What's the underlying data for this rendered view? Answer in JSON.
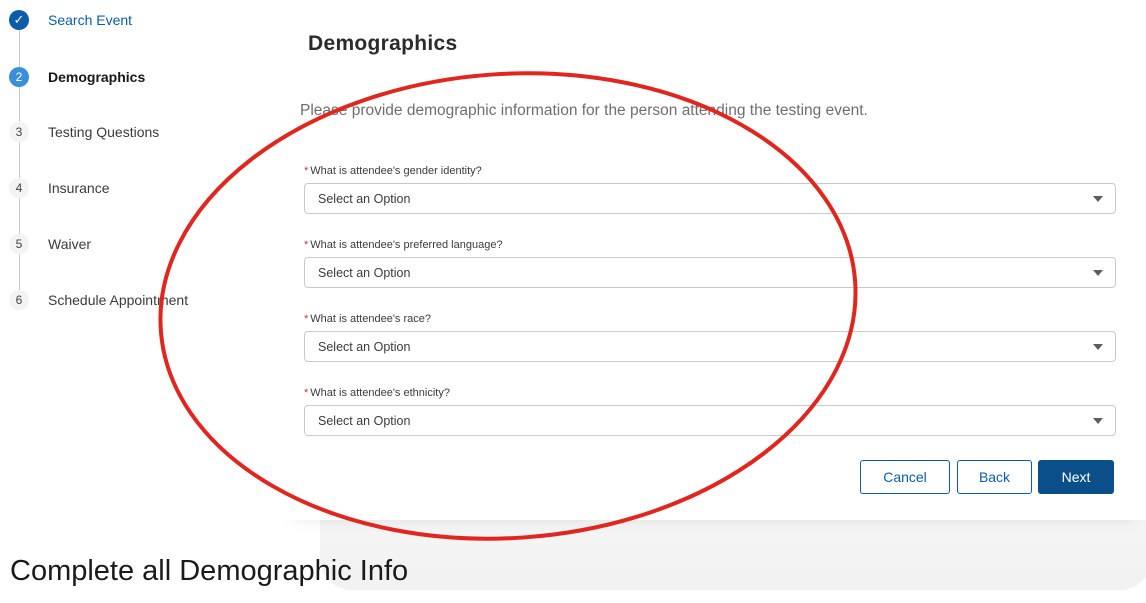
{
  "steps": [
    {
      "number": "✓",
      "label": "Search Event",
      "state": "done"
    },
    {
      "number": "2",
      "label": "Demographics",
      "state": "active"
    },
    {
      "number": "3",
      "label": "Testing Questions",
      "state": "pending"
    },
    {
      "number": "4",
      "label": "Insurance",
      "state": "pending"
    },
    {
      "number": "5",
      "label": "Waiver",
      "state": "pending"
    },
    {
      "number": "6",
      "label": "Schedule Appointment",
      "state": "pending"
    }
  ],
  "form": {
    "title": "Demographics",
    "intro": "Please provide demographic information for the person attending the testing event.",
    "required_marker": "*",
    "fields": [
      {
        "label": "What is attendee's gender identity?",
        "value": "Select an Option"
      },
      {
        "label": "What is attendee's preferred language?",
        "value": "Select an Option"
      },
      {
        "label": "What is attendee's race?",
        "value": "Select an Option"
      },
      {
        "label": "What is attendee's ethnicity?",
        "value": "Select an Option"
      }
    ],
    "buttons": {
      "cancel": "Cancel",
      "back": "Back",
      "next": "Next"
    }
  },
  "caption": "Complete all Demographic Info",
  "colors": {
    "accent": "#0b5cab",
    "annotation": "#e0261f",
    "required": "#c23934"
  }
}
